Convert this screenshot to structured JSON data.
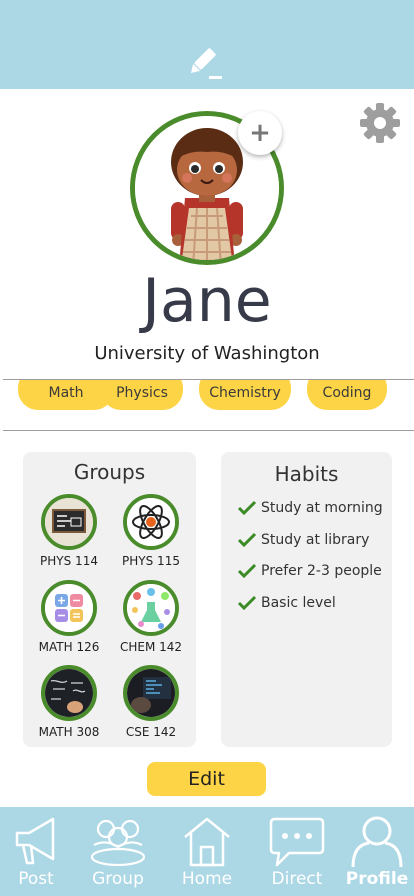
{
  "profile": {
    "name": "Jane",
    "school": "University of Washington",
    "add_symbol": "+"
  },
  "tags": [
    "Math",
    "Physics",
    "Chemistry",
    "Coding"
  ],
  "groups": {
    "title": "Groups",
    "items": [
      {
        "label": "PHYS 114",
        "icon": "blackboard-icon"
      },
      {
        "label": "PHYS 115",
        "icon": "atom-icon"
      },
      {
        "label": "MATH 126",
        "icon": "math-symbols-icon"
      },
      {
        "label": "CHEM 142",
        "icon": "chemistry-flasks-icon"
      },
      {
        "label": "MATH 308",
        "icon": "chalkboard-writing-icon"
      },
      {
        "label": "CSE 142",
        "icon": "laptop-code-icon"
      }
    ]
  },
  "habits": {
    "title": "Habits",
    "items": [
      "Study at morning",
      "Study at library",
      "Prefer 2-3 people",
      "Basic level"
    ]
  },
  "actions": {
    "edit_label": "Edit"
  },
  "nav": {
    "items": [
      {
        "label": "Post",
        "icon": "megaphone-icon"
      },
      {
        "label": "Group",
        "icon": "people-group-icon"
      },
      {
        "label": "Home",
        "icon": "home-icon"
      },
      {
        "label": "Direct",
        "icon": "chat-bubble-icon"
      },
      {
        "label": "Profile",
        "icon": "person-icon"
      }
    ],
    "active": "Profile"
  },
  "colors": {
    "header_bg": "#acd7e5",
    "accent_yellow": "#fdd446",
    "ring_green": "#4a8c2b",
    "check_green": "#3b8a26",
    "panel_bg": "#f1f1f1",
    "name_text": "#373a48"
  }
}
